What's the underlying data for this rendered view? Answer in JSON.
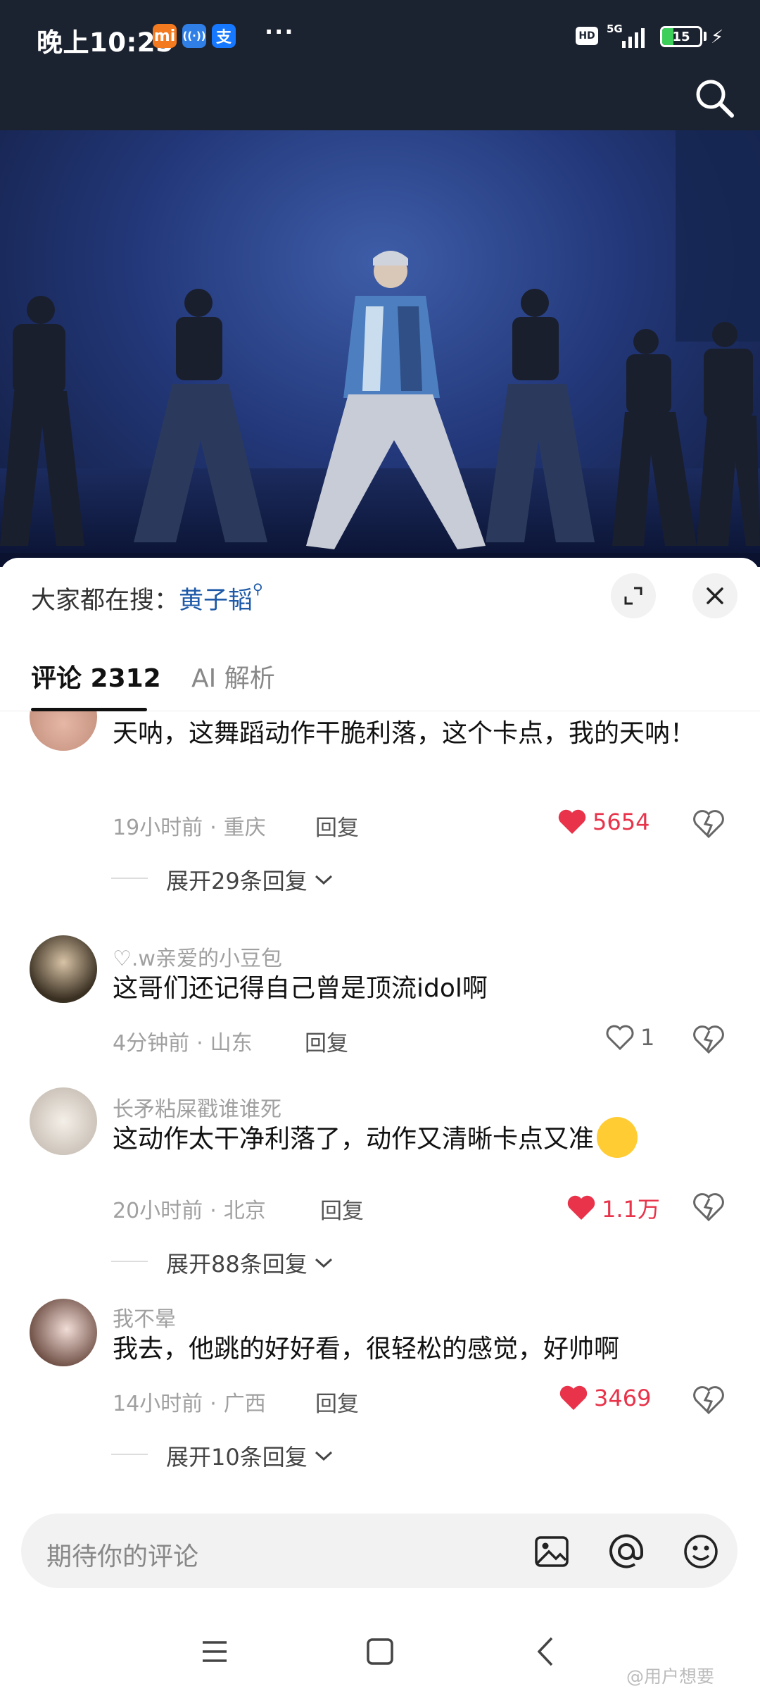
{
  "status_bar": {
    "time": "晚上10:25",
    "notif_icons": [
      "mi",
      "((·))",
      "支"
    ],
    "more": "···",
    "hd": "HD",
    "network": "5G",
    "battery": "15"
  },
  "top": {
    "search_icon": "search-icon"
  },
  "sheet": {
    "hot_search_prefix": "大家都在搜：",
    "hot_search_keyword": "黄子韬",
    "tabs": [
      {
        "label": "评论 2312"
      },
      {
        "label": "AI 解析"
      }
    ]
  },
  "comments": [
    {
      "username": "",
      "text": "天呐，这舞蹈动作干脆利落，这个卡点，我的天呐！",
      "time": "19小时前",
      "location": "重庆",
      "reply": "回复",
      "likes": "5654",
      "liked": true,
      "expand": "展开29条回复"
    },
    {
      "username": "♡.w亲爱的小豆包",
      "text": "这哥们还记得自己曾是顶流idol啊",
      "time": "4分钟前",
      "location": "山东",
      "reply": "回复",
      "likes": "1",
      "liked": false,
      "expand": ""
    },
    {
      "username": "长矛粘屎戳谁谁死",
      "text": "这动作太干净利落了，动作又清晰卡点又准",
      "time": "20小时前",
      "location": "北京",
      "reply": "回复",
      "likes": "1.1万",
      "liked": true,
      "expand": "展开88条回复"
    },
    {
      "username": "我不晕",
      "text": "我去，他跳的好好看，很轻松的感觉，好帅啊",
      "time": "14小时前",
      "location": "广西",
      "reply": "回复",
      "likes": "3469",
      "liked": true,
      "expand": "展开10条回复"
    }
  ],
  "input": {
    "placeholder": "期待你的评论"
  },
  "watermark": "@用户想要",
  "colors": {
    "like_red": "#e8334a",
    "keyword_blue": "#1e5aa8",
    "status_bg": "#1c2330"
  }
}
